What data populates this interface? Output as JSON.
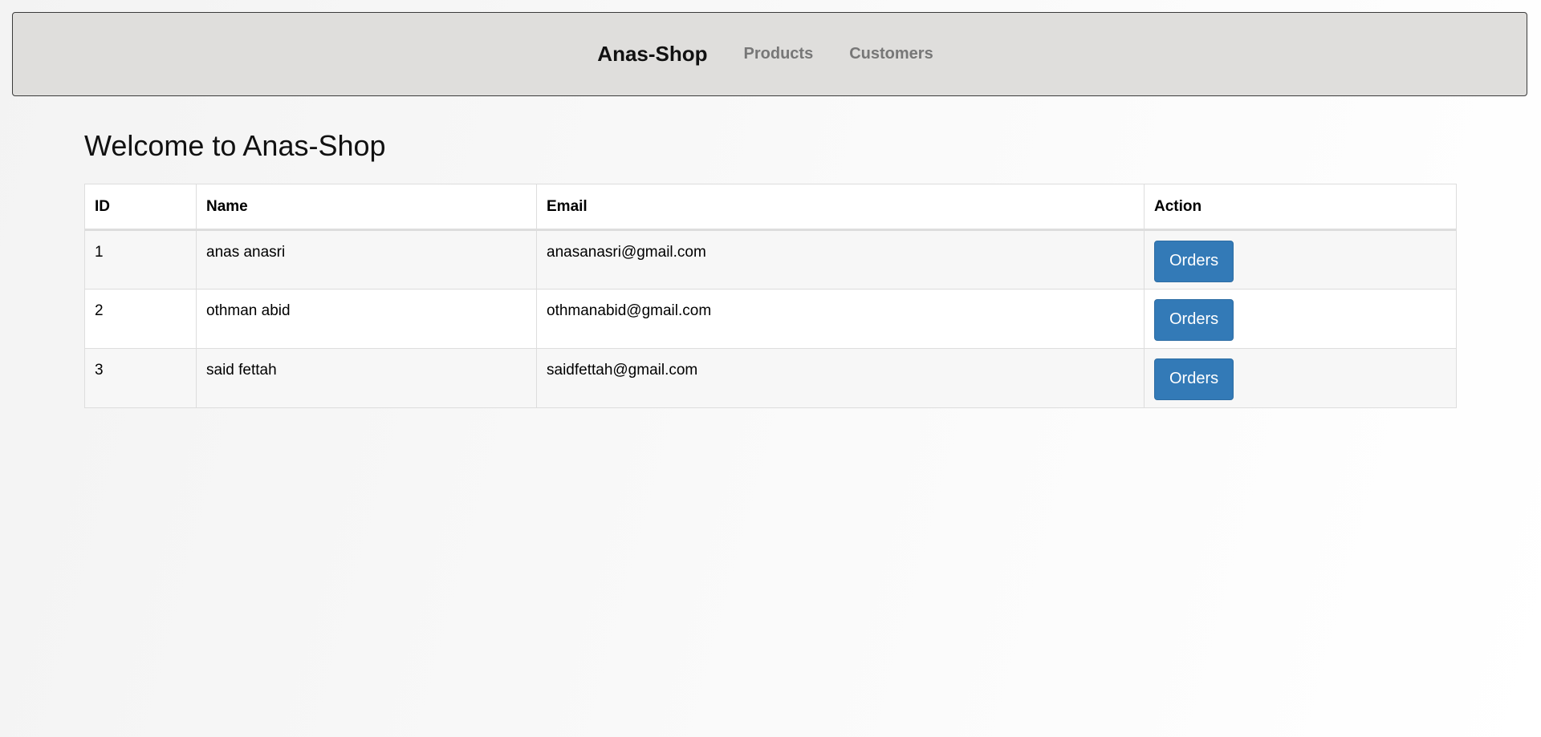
{
  "navbar": {
    "brand": "Anas-Shop",
    "links": [
      {
        "label": "Products"
      },
      {
        "label": "Customers"
      }
    ]
  },
  "page": {
    "title": "Welcome to Anas-Shop"
  },
  "table": {
    "headers": [
      "ID",
      "Name",
      "Email",
      "Action"
    ],
    "rows": [
      {
        "id": "1",
        "name": "anas anasri",
        "email": "anasanasri@gmail.com",
        "action": "Orders"
      },
      {
        "id": "2",
        "name": "othman abid",
        "email": "othmanabid@gmail.com",
        "action": "Orders"
      },
      {
        "id": "3",
        "name": "said fettah",
        "email": "saidfettah@gmail.com",
        "action": "Orders"
      }
    ]
  },
  "colors": {
    "navbar_bg": "#dfdedc",
    "button_primary": "#337ab7",
    "nav_link": "#777777"
  }
}
